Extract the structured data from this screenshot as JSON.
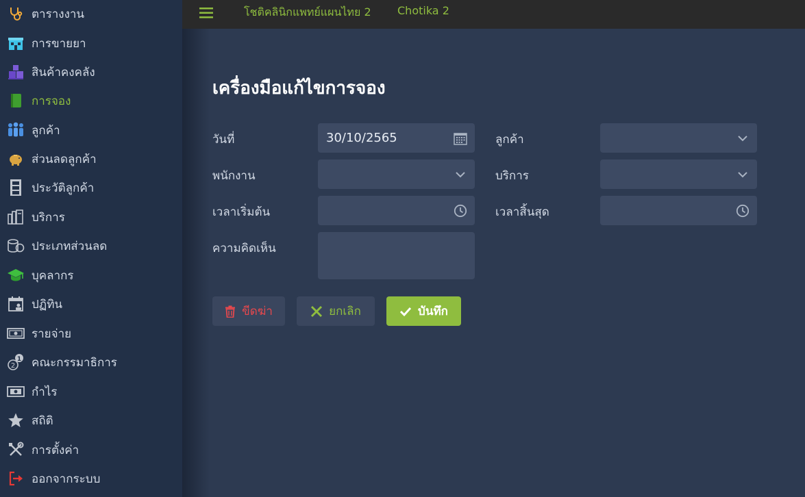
{
  "sidebar": {
    "items": [
      {
        "label": "ตารางงาน",
        "icon": "stethoscope-icon"
      },
      {
        "label": "การขายยา",
        "icon": "pharmacy-icon"
      },
      {
        "label": "สินค้าคงคลัง",
        "icon": "boxes-icon"
      },
      {
        "label": "การจอง",
        "icon": "book-icon"
      },
      {
        "label": "ลูกค้า",
        "icon": "users-icon"
      },
      {
        "label": "ส่วนลดลูกค้า",
        "icon": "piggy-bank-icon"
      },
      {
        "label": "ประวัติลูกค้า",
        "icon": "file-cabinet-icon"
      },
      {
        "label": "บริการ",
        "icon": "books-icon"
      },
      {
        "label": "ประเภทส่วนลด",
        "icon": "coins-icon"
      },
      {
        "label": "บุคลากร",
        "icon": "graduation-cap-icon"
      },
      {
        "label": "ปฏิทิน",
        "icon": "calendar-user-icon"
      },
      {
        "label": "รายจ่าย",
        "icon": "banknote-icon"
      },
      {
        "label": "คณะกรรมาธิการ",
        "icon": "commission-icon"
      },
      {
        "label": "กำไร",
        "icon": "money-icon"
      },
      {
        "label": "สถิติ",
        "icon": "star-icon"
      },
      {
        "label": "การตั้งค่า",
        "icon": "tools-icon"
      },
      {
        "label": "ออกจากระบบ",
        "icon": "logout-icon"
      }
    ],
    "active_index": 3
  },
  "topbar": {
    "clinic_name": "โชติคลินิกแพทย์แผนไทย 2",
    "user_name": "Chotika 2"
  },
  "form": {
    "title": "เครื่องมือแก้ไขการจอง",
    "date_label": "วันที่",
    "date_value": "30/10/2565",
    "customer_label": "ลูกค้า",
    "customer_value": "",
    "staff_label": "พนักงาน",
    "staff_value": "",
    "service_label": "บริการ",
    "service_value": "",
    "start_time_label": "เวลาเริ่มต้น",
    "start_time_value": "",
    "end_time_label": "เวลาสิ้นสุด",
    "end_time_value": "",
    "comment_label": "ความคิดเห็น",
    "comment_value": ""
  },
  "buttons": {
    "delete_label": "ขีดฆ่า",
    "cancel_label": "ยกเลิก",
    "save_label": "บันทึก"
  },
  "colors": {
    "accent": "#8fbd3f",
    "danger": "#e5484d",
    "sidebar_bg": "#223047",
    "content_bg": "#2d3a51",
    "field_bg": "#3d4a63"
  }
}
